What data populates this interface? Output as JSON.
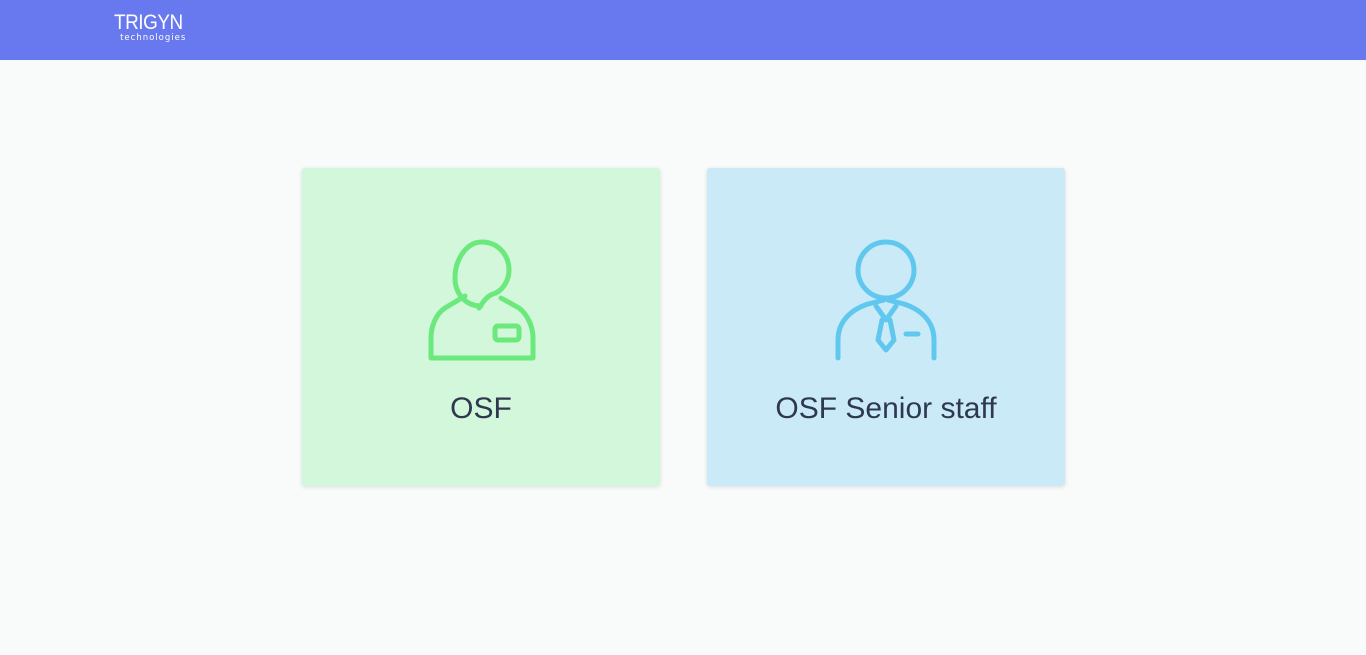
{
  "header": {
    "logo_main": "TRIGYN",
    "logo_sub": "technologies",
    "background": "#6879f0"
  },
  "cards": [
    {
      "label": "OSF",
      "icon": "staff-user-icon",
      "background": "#d2f7da",
      "icon_color": "#6be97d"
    },
    {
      "label": "OSF Senior staff",
      "icon": "senior-staff-user-icon",
      "background": "#cbeaf7",
      "icon_color": "#60c8ef"
    }
  ],
  "page_background": "#f9fbfb",
  "label_color": "#2e3850"
}
